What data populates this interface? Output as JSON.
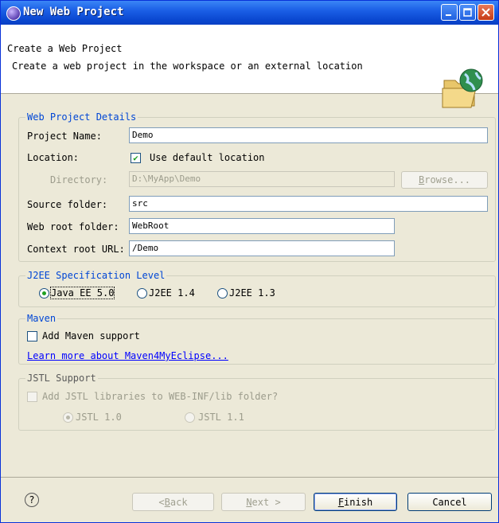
{
  "window": {
    "title": "New Web Project"
  },
  "header": {
    "title": "Create a Web Project",
    "description": "Create a web project in the workspace or an external location"
  },
  "details": {
    "legend": "Web Project Details",
    "project_name_label": "Project Name:",
    "project_name_value": "Demo",
    "location_label": "Location:",
    "use_default_label": "Use default location",
    "use_default_checked": true,
    "directory_label": "Directory:",
    "directory_value": "D:\\MyApp\\Demo",
    "browse_label": "Browse...",
    "source_folder_label": "Source folder:",
    "source_folder_value": "src",
    "web_root_label": "Web root folder:",
    "web_root_value": "WebRoot",
    "context_root_label": "Context root URL:",
    "context_root_value": "/Demo"
  },
  "j2ee": {
    "legend": "J2EE Specification Level",
    "options": [
      "Java EE 5.0",
      "J2EE 1.4",
      "J2EE 1.3"
    ],
    "selected": "Java EE 5.0"
  },
  "maven": {
    "legend": "Maven",
    "add_support_label": "Add Maven support",
    "learn_more_link": "Learn more about Maven4MyEclipse..."
  },
  "jstl": {
    "legend": "JSTL Support",
    "add_libraries_label": "Add JSTL libraries to WEB-INF/lib folder?",
    "options": [
      "JSTL 1.0",
      "JSTL 1.1"
    ],
    "selected": "JSTL 1.0"
  },
  "footer": {
    "back_label": "< Back",
    "next_label": "Next >",
    "finish_label": "Finish",
    "cancel_label": "Cancel"
  },
  "colors": {
    "title_bar": "#0a47d0",
    "dialog_bg": "#ece9d8",
    "section_title": "#0046d5",
    "link": "#0000ff",
    "check_mark": "#21a121"
  }
}
